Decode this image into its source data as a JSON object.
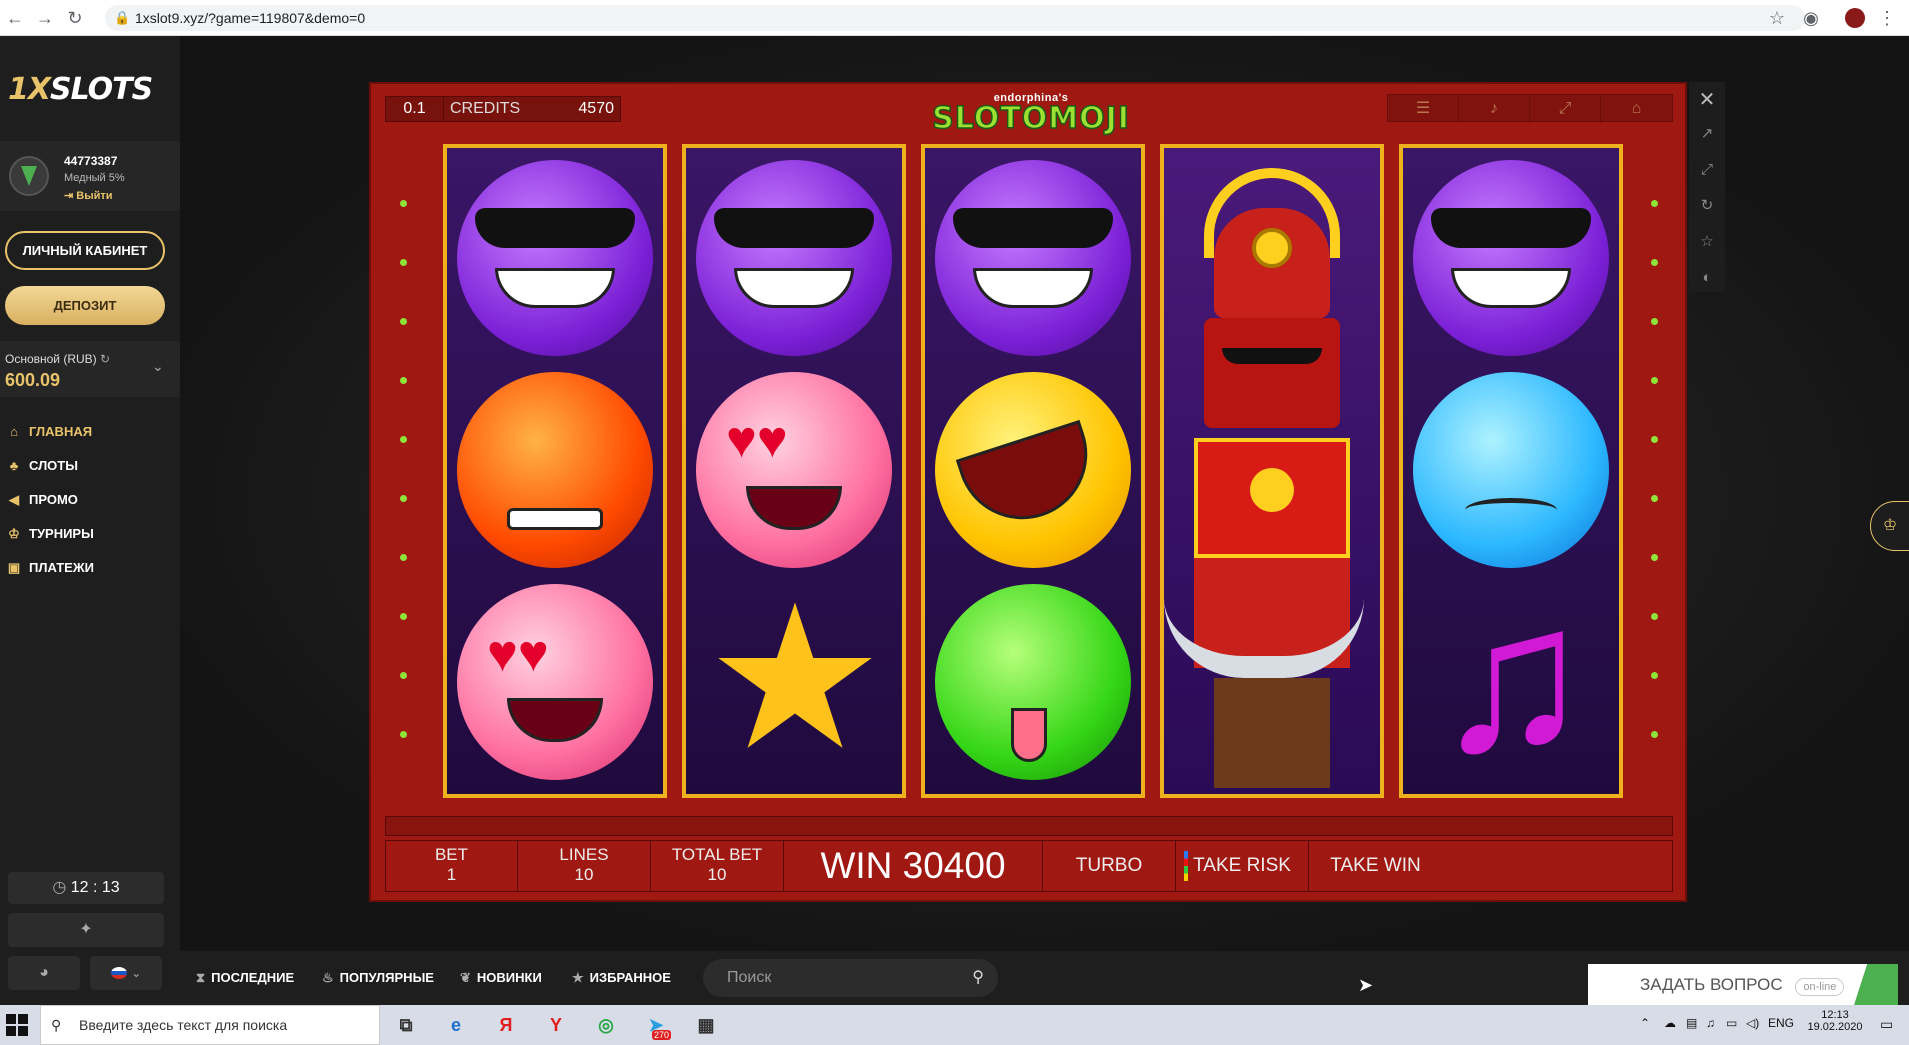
{
  "browser": {
    "url": "1xslot9.xyz/?game=119807&demo=0",
    "back_icon": "arrow-left-icon",
    "forward_icon": "arrow-right-icon",
    "reload_icon": "reload-icon"
  },
  "sidebar": {
    "logo": {
      "prefix": "1X",
      "suffix": "SLOTS"
    },
    "user": {
      "id": "44773387",
      "level": "Медный 5%",
      "logout": "Выйти"
    },
    "cabinet_button": "ЛИЧНЫЙ КАБИНЕТ",
    "deposit_button": "ДЕПОЗИТ",
    "balance": {
      "label": "Основной (RUB)",
      "value": "600.09"
    },
    "menu": [
      {
        "label": "ГЛАВНАЯ",
        "icon": "home-icon",
        "glyph": "⌂"
      },
      {
        "label": "СЛОТЫ",
        "icon": "cherries-icon",
        "glyph": "♣"
      },
      {
        "label": "ПРОМО",
        "icon": "megaphone-icon",
        "glyph": "◀"
      },
      {
        "label": "ТУРНИРЫ",
        "icon": "trophy-icon",
        "glyph": "♔"
      },
      {
        "label": "ПЛАТЕЖИ",
        "icon": "wallet-icon",
        "glyph": "▣"
      }
    ],
    "clock": "12 : 13"
  },
  "game": {
    "title_sub": "endorphina's",
    "title_main": "SLOTOMOJI",
    "denomination": "0.1",
    "credits_label": "CREDITS",
    "credits_value": "4570",
    "reels": [
      [
        "cool-emoji",
        "angry-emoji",
        "heart-eyes-emoji"
      ],
      [
        "cool-emoji",
        "heart-eyes-emoji",
        "star-symbol"
      ],
      [
        "cool-emoji",
        "laughing-emoji",
        "sick-emoji"
      ],
      [
        "samurai-wild"
      ],
      [
        "cool-emoji",
        "crying-emoji",
        "music-note-symbol"
      ]
    ],
    "bet_label": "BET",
    "bet_value": "1",
    "lines_label": "LINES",
    "lines_value": "10",
    "total_bet_label": "TOTAL BET",
    "total_bet_value": "10",
    "win_text": "WIN 30400",
    "turbo": "TURBO",
    "take_risk": "TAKE RISK",
    "take_win": "TAKE WIN"
  },
  "bottom": {
    "tabs": [
      "ПОСЛЕДНИЕ",
      "ПОПУЛЯРНЫЕ",
      "НОВИНКИ",
      "ИЗБРАННОЕ"
    ],
    "search_placeholder": "Поиск",
    "ask_label": "ЗАДАТЬ ВОПРОС",
    "ask_status": "on-line"
  },
  "taskbar": {
    "search_placeholder": "Введите здесь текст для поиска",
    "telegram_badge": "270",
    "lang": "ENG",
    "time": "12:13",
    "date": "19.02.2020"
  },
  "colors": {
    "accent": "#e8c36a",
    "game_red": "#a01812",
    "reel_border": "#f0b21c"
  }
}
